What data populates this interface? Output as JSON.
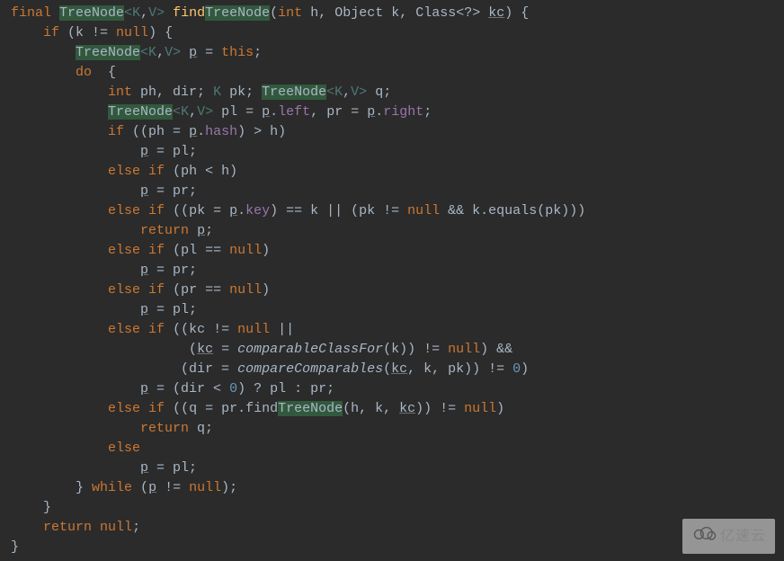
{
  "code": {
    "l1": {
      "kw1": "final",
      "hl1": "TreeNode",
      "gen1": "<",
      "k": "K",
      "c1": ",",
      "v": "V",
      "gen2": ">",
      "fn_pre": " find",
      "hl2": "TreeNode",
      "sig_open": "(",
      "kw_int": "int",
      "p_h": " h, Object k, Class<?> ",
      "p_kc": "kc",
      "sig_close": ") {"
    },
    "l2": {
      "kw_if": "if",
      "cond": " (k != ",
      "kw_null": "null",
      "close": ") {"
    },
    "l3": {
      "hl": "TreeNode",
      "gen1": "<",
      "k": "K",
      "c1": ",",
      "v": "V",
      "gen2": ">",
      "sp": " ",
      "p": "p",
      "rest": " = ",
      "kw_this": "this",
      "semi": ";"
    },
    "l4": {
      "kw_do": "do",
      "brace": "  {"
    },
    "l5": {
      "kw_int": "int",
      "a": " ph, dir; ",
      "k": "K",
      "b": " pk; ",
      "hl": "TreeNode",
      "gen1": "<",
      "gk": "K",
      "c1": ",",
      "gv": "V",
      "gen2": ">",
      "c": " q;"
    },
    "l6": {
      "hl": "TreeNode",
      "gen1": "<",
      "k": "K",
      "c1": ",",
      "v": "V",
      "gen2": ">",
      "a": " pl = ",
      "p1": "p",
      "dot1": ".",
      "f1": "left",
      "b": ", pr = ",
      "p2": "p",
      "dot2": ".",
      "f2": "right",
      "semi": ";"
    },
    "l7": {
      "kw_if": "if",
      "a": " ((ph = ",
      "p": "p",
      "dot": ".",
      "f": "hash",
      "b": ") > h)"
    },
    "l8": {
      "p": "p",
      "rest": " = pl;"
    },
    "l9": {
      "kw1": "else",
      "kw2": " if",
      "rest": " (ph < h)"
    },
    "l10": {
      "p": "p",
      "rest": " = pr;"
    },
    "l11": {
      "kw1": "else",
      "kw2": " if",
      "a": " ((pk = ",
      "p": "p",
      "dot": ".",
      "f": "key",
      "b": ") == k || (pk != ",
      "kw_null": "null",
      "c": " && k.equals(pk)))"
    },
    "l12": {
      "kw_ret": "return",
      "sp": " ",
      "p": "p",
      "semi": ";"
    },
    "l13": {
      "kw1": "else",
      "kw2": " if",
      "a": " (pl == ",
      "kw_null": "null",
      "b": ")"
    },
    "l14": {
      "p": "p",
      "rest": " = pr;"
    },
    "l15": {
      "kw1": "else",
      "kw2": " if",
      "a": " (pr == ",
      "kw_null": "null",
      "b": ")"
    },
    "l16": {
      "p": "p",
      "rest": " = pl;"
    },
    "l17": {
      "kw1": "else",
      "kw2": " if",
      "a": " ((kc != ",
      "kw_null": "null",
      "b": " ||"
    },
    "l18": {
      "a": "          (",
      "kc": "kc",
      "b": " = ",
      "fn": "comparableClassFor",
      "c": "(k)) != ",
      "kw_null": "null",
      "d": ") &&"
    },
    "l19": {
      "a": "         (dir = ",
      "fn": "compareComparables",
      "b": "(",
      "kc": "kc",
      "c": ", k, pk)) != ",
      "num": "0",
      "d": ")"
    },
    "l20": {
      "p": "p",
      "a": " = (dir < ",
      "num": "0",
      "b": ") ? pl : pr;"
    },
    "l21": {
      "kw1": "else",
      "kw2": " if",
      "a": " ((q = pr.find",
      "hl": "TreeNode",
      "b": "(h, k, ",
      "kc": "kc",
      "c": ")) != ",
      "kw_null": "null",
      "d": ")"
    },
    "l22": {
      "kw_ret": "return",
      "rest": " q;"
    },
    "l23": {
      "kw": "else"
    },
    "l24": {
      "p": "p",
      "rest": " = pl;"
    },
    "l25": {
      "a": "} ",
      "kw": "while",
      "b": " (",
      "p": "p",
      "c": " != ",
      "kw_null": "null",
      "d": ");"
    },
    "l26": {
      "brace": "}"
    },
    "l27": {
      "kw_ret": "return",
      "sp": " ",
      "kw_null": "null",
      "semi": ";"
    },
    "l28": {
      "brace": "}"
    }
  },
  "watermark": {
    "text": "亿速云"
  }
}
